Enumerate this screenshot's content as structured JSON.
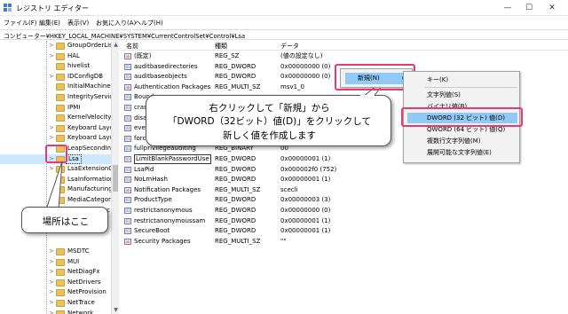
{
  "window": {
    "title": "レジストリ エディター",
    "minimize": "—",
    "maximize": "☐",
    "close": "✕"
  },
  "menubar": [
    "ファイル(F)",
    "編集(E)",
    "表示(V)",
    "お気に入り(A)",
    "ヘルプ(H)"
  ],
  "address": "コンピューター¥HKEY_LOCAL_MACHINE¥SYSTEM¥CurrentControlSet¥Control¥Lsa",
  "tree": [
    {
      "label": "GroupOrderLis",
      "chevron": ">"
    },
    {
      "label": "HAL",
      "chevron": ">"
    },
    {
      "label": "hivelist",
      "chevron": ""
    },
    {
      "label": "IDConfigDB",
      "chevron": ">"
    },
    {
      "label": "InitialMachine",
      "chevron": ""
    },
    {
      "label": "IntegrityServic",
      "chevron": ""
    },
    {
      "label": "IPMI",
      "chevron": ""
    },
    {
      "label": "KernelVelocity",
      "chevron": ""
    },
    {
      "label": "Keyboard Layo",
      "chevron": ">"
    },
    {
      "label": "Keyboard Layo",
      "chevron": ">"
    },
    {
      "label": "LeapSecondIn",
      "chevron": ""
    },
    {
      "label": "Lsa",
      "chevron": ">",
      "selected": true
    },
    {
      "label": "LsaExtensionC",
      "chevron": ">"
    },
    {
      "label": "LsaInformation",
      "chevron": ""
    },
    {
      "label": "Manufacturing",
      "chevron": ""
    },
    {
      "label": "MediaCategor",
      "chevron": ">"
    },
    {
      "label": "MediaInterfac",
      "chevron": ">"
    },
    {
      "label": "",
      "chevron": ""
    },
    {
      "label": "",
      "chevron": ""
    },
    {
      "label": "",
      "chevron": ""
    },
    {
      "label": "MSDTC",
      "chevron": ">"
    },
    {
      "label": "MUI",
      "chevron": ">"
    },
    {
      "label": "NetDiagFx",
      "chevron": ">"
    },
    {
      "label": "NetDrivers",
      "chevron": ">"
    },
    {
      "label": "NetProvision",
      "chevron": ">"
    },
    {
      "label": "NetTrace",
      "chevron": ">"
    },
    {
      "label": "Network",
      "chevron": ">"
    }
  ],
  "list": {
    "headers": {
      "name": "名前",
      "type": "種類",
      "data": "データ"
    },
    "rows": [
      {
        "icon": "ab",
        "name": "(既定)",
        "type": "REG_SZ",
        "data": "(値の設定なし)"
      },
      {
        "icon": "01",
        "name": "auditbasedirectories",
        "type": "REG_DWORD",
        "data": "0x00000000 (0)"
      },
      {
        "icon": "01",
        "name": "auditbaseobjects",
        "type": "REG_DWORD",
        "data": "0x00000000 (0)"
      },
      {
        "icon": "ab",
        "name": "Authentication Packages",
        "type": "REG_MULTI_SZ",
        "data": "msv1_0"
      },
      {
        "icon": "01",
        "name": "Bounds",
        "type": "",
        "data": ""
      },
      {
        "icon": "01",
        "name": "crashonau",
        "type": "",
        "data": ""
      },
      {
        "icon": "01",
        "name": "disabledor",
        "type": "",
        "data": ""
      },
      {
        "icon": "01",
        "name": "everyoneir",
        "type": "",
        "data": ""
      },
      {
        "icon": "01",
        "name": "forceguest",
        "type": "",
        "data": ""
      },
      {
        "icon": "01",
        "name": "fullprivilegeauditing",
        "type": "REG_BINARY",
        "data": "00"
      },
      {
        "icon": "01",
        "name": "LimitBlankPasswordUse",
        "type": "REG_DWORD",
        "data": "0x00000001 (1)",
        "focused": true
      },
      {
        "icon": "01",
        "name": "LsaPid",
        "type": "REG_DWORD",
        "data": "0x000002f0 (752)"
      },
      {
        "icon": "01",
        "name": "NoLmHash",
        "type": "REG_DWORD",
        "data": "0x00000001 (1)"
      },
      {
        "icon": "ab",
        "name": "Notification Packages",
        "type": "REG_MULTI_SZ",
        "data": "scecli"
      },
      {
        "icon": "01",
        "name": "ProductType",
        "type": "REG_DWORD",
        "data": "0x00000003 (3)"
      },
      {
        "icon": "01",
        "name": "restrictanonymous",
        "type": "REG_DWORD",
        "data": "0x00000000 (0)"
      },
      {
        "icon": "01",
        "name": "restrictanonymoussam",
        "type": "REG_DWORD",
        "data": "0x00000001 (1)"
      },
      {
        "icon": "01",
        "name": "SecureBoot",
        "type": "REG_DWORD",
        "data": "0x00000001 (1)"
      },
      {
        "icon": "ab",
        "name": "Security Packages",
        "type": "REG_MULTI_SZ",
        "data": "\"\""
      }
    ]
  },
  "context_menu": {
    "new_label": "新規(N)",
    "arrow": "›"
  },
  "submenu": {
    "key": "キー(K)",
    "string": "文字列値(S)",
    "binary": "バイナリ値(B)",
    "dword": "DWORD (32 ビット) 値(D)",
    "qword": "QWORD (64 ビット) 値(Q)",
    "multi": "複数行文字列値(M)",
    "expand": "展開可能な文字列値(E)"
  },
  "callout_main": {
    "line1": "右クリックして「新規」から",
    "line2": "「DWORD（32ビット）値(D)」をクリックして",
    "line3": "新しく値を作成します"
  },
  "callout_place": "場所はここ",
  "colors": {
    "highlight_pink": "#e83a72",
    "menu_hover_blue": "#91c9f7",
    "tree_selected": "#cce8ff"
  }
}
